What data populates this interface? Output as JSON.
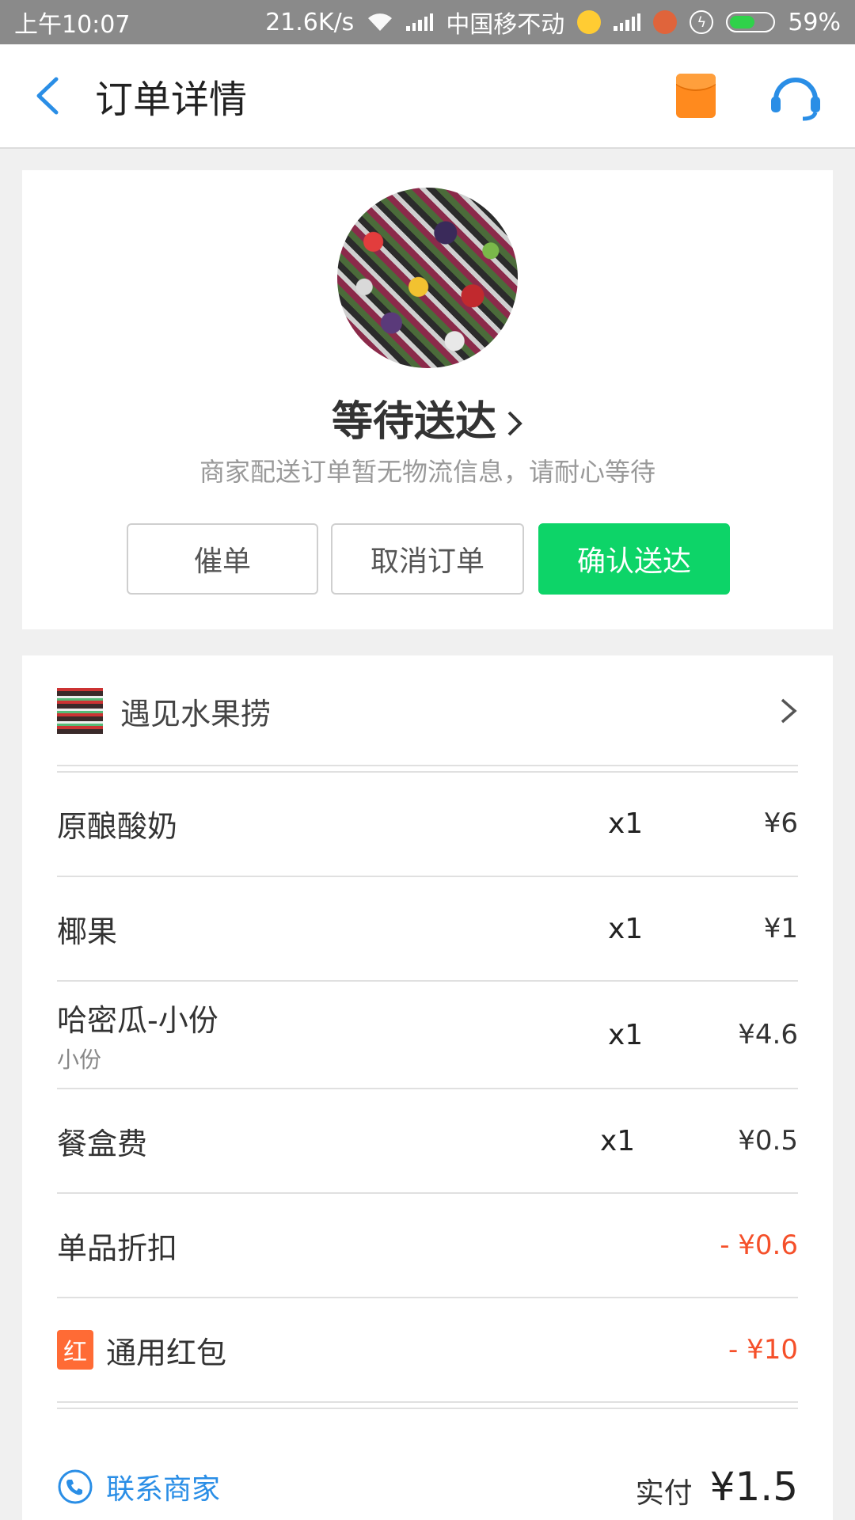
{
  "status_bar": {
    "time": "上午10:07",
    "net_speed": "21.6K/s",
    "carrier": "中国移不动",
    "battery": "59%",
    "battery_level": 0.59
  },
  "header": {
    "title": "订单详情"
  },
  "order_status": {
    "title": "等待送达",
    "subtitle": "商家配送订单暂无物流信息，请耐心等待",
    "buttons": {
      "urge": "催单",
      "cancel": "取消订单",
      "confirm": "确认送达"
    }
  },
  "shop": {
    "name": "遇见水果捞"
  },
  "items": [
    {
      "name": "原酿酸奶",
      "sub": "",
      "qty": "x1",
      "price": "¥6"
    },
    {
      "name": "椰果",
      "sub": "",
      "qty": "x1",
      "price": "¥1"
    },
    {
      "name": "哈密瓜-小份",
      "sub": "小份",
      "qty": "x1",
      "price": "¥4.6"
    },
    {
      "name": "餐盒费",
      "sub": "",
      "qty": "x1",
      "price": "¥0.5"
    }
  ],
  "discounts": {
    "item_discount_label": "单品折扣",
    "item_discount_value": "- ¥0.6",
    "redpacket_badge": "红",
    "redpacket_label": "通用红包",
    "redpacket_value": "- ¥10"
  },
  "footer": {
    "contact": "联系商家",
    "paid_label": "实付",
    "paid_value": "¥1.5"
  },
  "colors": {
    "confirm_green": "#0dd468",
    "accent_blue": "#2a8ee6",
    "discount_red": "#f5502a",
    "hongbao_orange": "#ff8a1e"
  }
}
